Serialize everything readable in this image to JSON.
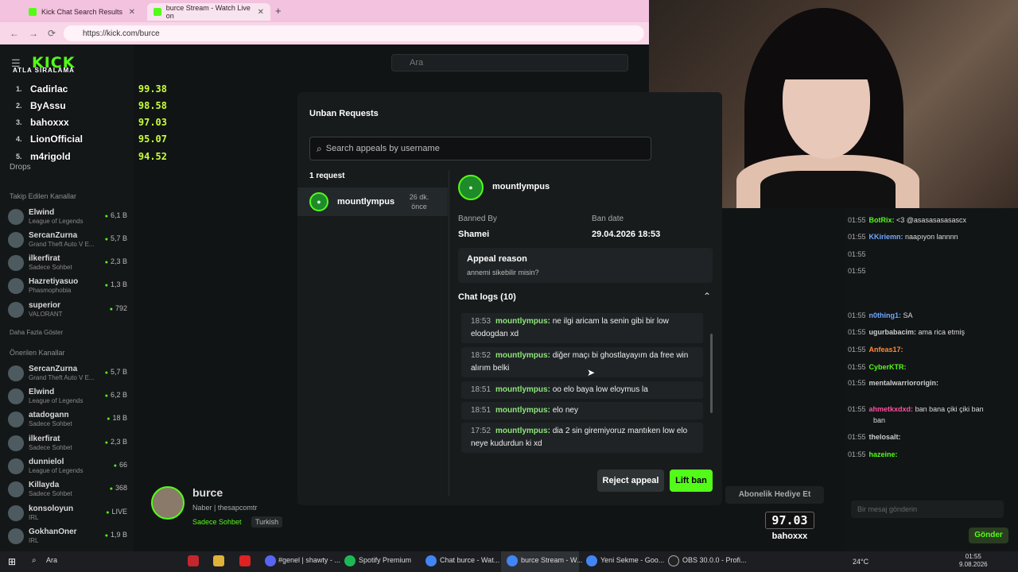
{
  "browser": {
    "tabs": [
      {
        "title": "Kick Chat Search Results"
      },
      {
        "title": "burce Stream - Watch Live on"
      }
    ],
    "url": "https://kick.com/burce",
    "newtab": "+"
  },
  "site": {
    "logo": "KICK",
    "search_placeholder": "Ara"
  },
  "leaderboard": {
    "title": "ATLA SIRALAMA",
    "rows": [
      {
        "rank": "1.",
        "name": "Cadirlac",
        "score": "99.38"
      },
      {
        "rank": "2.",
        "name": "ByAssu",
        "score": "98.58"
      },
      {
        "rank": "3.",
        "name": "bahoxxx",
        "score": "97.03"
      },
      {
        "rank": "4.",
        "name": "LionOfficial",
        "score": "95.07"
      },
      {
        "rank": "5.",
        "name": "m4rigold",
        "score": "94.52"
      }
    ]
  },
  "sidebar": {
    "drops": "Drops",
    "followed_title": "Takip Edilen Kanallar",
    "followed": [
      {
        "name": "Elwind",
        "game": "League of Legends",
        "viewers": "6,1 B"
      },
      {
        "name": "SercanZurna",
        "game": "Grand Theft Auto V E...",
        "viewers": "5,7 B"
      },
      {
        "name": "ilkerfirat",
        "game": "Sadece Sohbet",
        "viewers": "2,3 B"
      },
      {
        "name": "Hazretiyasuo",
        "game": "Phasmophobia",
        "viewers": "1,3 B"
      },
      {
        "name": "superior",
        "game": "VALORANT",
        "viewers": "792"
      }
    ],
    "show_more": "Daha Fazla Göster",
    "recommended_title": "Önerilen Kanallar",
    "recommended": [
      {
        "name": "SercanZurna",
        "game": "Grand Theft Auto V E...",
        "viewers": "5,7 B"
      },
      {
        "name": "Elwind",
        "game": "League of Legends",
        "viewers": "6,2 B"
      },
      {
        "name": "atadogann",
        "game": "Sadece Sohbet",
        "viewers": "18 B"
      },
      {
        "name": "ilkerfirat",
        "game": "Sadece Sohbet",
        "viewers": "2,3 B"
      },
      {
        "name": "dunnielol",
        "game": "League of Legends",
        "viewers": "66"
      },
      {
        "name": "Killayda",
        "game": "Sadece Sohbet",
        "viewers": "368"
      },
      {
        "name": "konsoloyun",
        "game": "IRL",
        "viewers": "LIVE"
      },
      {
        "name": "GokhanOner",
        "game": "IRL",
        "viewers": "1,9 B"
      }
    ]
  },
  "stream": {
    "streamer": "burce",
    "title": "Naber | thesapcomtr",
    "category": "Sadece Sohbet",
    "tag": "Turkish",
    "subscribe": "Abonelik Hediye Et",
    "overlay_score": "97.03",
    "overlay_name": "bahoxxx"
  },
  "modal": {
    "title": "Unban Requests",
    "search_placeholder": "Search appeals by username",
    "request_count": "1 request",
    "request": {
      "username": "mountlympus",
      "time": "26 dk. önce"
    },
    "detail": {
      "username": "mountlympus",
      "banned_by_label": "Banned By",
      "banned_by": "Shamei",
      "ban_date_label": "Ban date",
      "ban_date": "29.04.2026 18:53",
      "appeal_reason_label": "Appeal reason",
      "appeal_reason": "annemi sikebilir misin?",
      "chat_logs_label": "Chat logs (10)"
    },
    "logs": [
      {
        "time": "18:53",
        "user": "mountlympus:",
        "text": "ne ilgi aricam la senin gibi bir low elodogdan xd"
      },
      {
        "time": "18:52",
        "user": "mountlympus:",
        "text": "diğer maçı bi ghostlayayım da free win alırım belki"
      },
      {
        "time": "18:51",
        "user": "mountlympus:",
        "text": "oo elo baya low eloymus la"
      },
      {
        "time": "18:51",
        "user": "mountlympus:",
        "text": "elo ney"
      },
      {
        "time": "17:52",
        "user": "mountlympus:",
        "text": "dia 2 sin giremiyoruz mantıken low elo neye kudurdun ki xd"
      }
    ],
    "reject_label": "Reject appeal",
    "lift_label": "Lift ban"
  },
  "chat": {
    "messages": [
      {
        "time": "01:55",
        "user": "BotRix:",
        "text": "<3 @asasasasasascx",
        "color": "#53fc18"
      },
      {
        "time": "01:55",
        "user": "KKiriemn:",
        "text": "naapıyon lannnn",
        "color": "#6fa8ff"
      },
      {
        "time": "01:55",
        "user": "",
        "text": "",
        "color": "#ff4fa0"
      },
      {
        "time": "01:55",
        "user": "",
        "text": "",
        "color": "#ff4fa0"
      },
      {
        "time": "01:55",
        "user": "n0thing1:",
        "text": "SA",
        "color": "#6fa8ff"
      },
      {
        "time": "01:55",
        "user": "ugurbabacim:",
        "text": "ama rica etmiş",
        "color": "#cccccc"
      },
      {
        "time": "01:55",
        "user": "Anfeas17:",
        "text": "",
        "color": "#ff8a3a"
      },
      {
        "time": "01:55",
        "user": "CyberKTR:",
        "text": "",
        "color": "#53fc18"
      },
      {
        "time": "01:55",
        "user": "mentalwarriororigin:",
        "text": "",
        "color": "#cccccc"
      },
      {
        "time": "01:55",
        "user": "ahmetkxdxd:",
        "text": "ban bana çiki çiki ban",
        "color": "#ff4fa0"
      },
      {
        "time": "",
        "user": "",
        "text": "ban",
        "color": "#dddddd"
      },
      {
        "time": "01:55",
        "user": "thelosalt:",
        "text": "",
        "color": "#cccccc"
      },
      {
        "time": "01:55",
        "user": "hazeine:",
        "text": "",
        "color": "#53fc18"
      }
    ],
    "input_placeholder": "Bir mesaj gönderin",
    "send_label": "Gönder"
  },
  "taskbar": {
    "search": "Ara",
    "apps": [
      {
        "label": "#genel | shawty - ..."
      },
      {
        "label": "Spotify Premium"
      },
      {
        "label": "Chat burce - Wat..."
      },
      {
        "label": "burce Stream - W..."
      },
      {
        "label": "Yeni Sekme - Goo..."
      },
      {
        "label": "OBS 30.0.0 - Profi..."
      }
    ],
    "weather": "24°C",
    "time": "01:55",
    "date": "9.08.2026"
  }
}
